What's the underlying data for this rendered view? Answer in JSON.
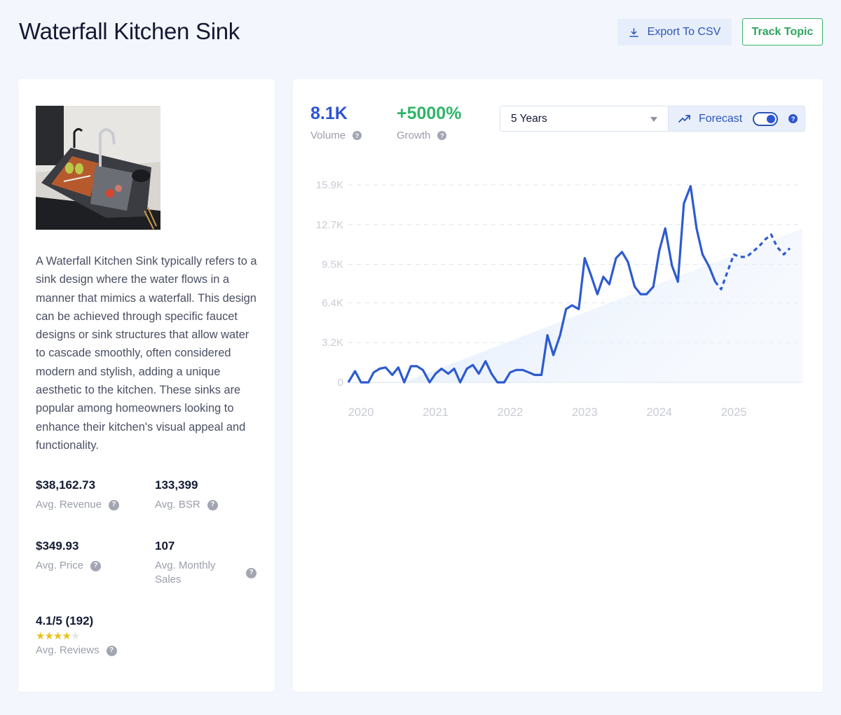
{
  "header": {
    "title": "Waterfall Kitchen Sink",
    "export_label": "Export To CSV",
    "track_label": "Track Topic"
  },
  "product": {
    "image_alt": "Waterfall kitchen sink product photo",
    "description": "A Waterfall Kitchen Sink typically refers to a sink design where the water flows in a manner that mimics a waterfall. This design can be achieved through specific faucet designs or sink structures that allow water to cascade smoothly, often considered modern and stylish, adding a unique aesthetic to the kitchen. These sinks are popular among homeowners looking to enhance their kitchen's visual appeal and functionality.",
    "stats": {
      "revenue": {
        "value": "$38,162.73",
        "label": "Avg. Revenue"
      },
      "bsr": {
        "value": "133,399",
        "label": "Avg. BSR"
      },
      "price": {
        "value": "$349.93",
        "label": "Avg. Price"
      },
      "monthly_sales": {
        "value": "107",
        "label": "Avg. Monthly Sales"
      },
      "reviews": {
        "value": "4.1/5 (192)",
        "label": "Avg. Reviews",
        "rating": 4.1,
        "max": 5,
        "stars_filled": 4
      }
    }
  },
  "metrics": {
    "volume": {
      "value": "8.1K",
      "label": "Volume"
    },
    "growth": {
      "value": "+5000%",
      "label": "Growth"
    }
  },
  "controls": {
    "period_selected": "5 Years",
    "forecast_label": "Forecast",
    "forecast_enabled": true
  },
  "colors": {
    "accent": "#2d55d0",
    "growth": "#2fb56a",
    "line": "#2d5bd0",
    "trend_fill": "#e3eefc",
    "grid": "#dde3ee"
  },
  "chart_data": {
    "type": "line",
    "title": "",
    "xlabel": "",
    "ylabel": "",
    "x_ticks": [
      "2020",
      "2021",
      "2022",
      "2023",
      "2024",
      "2025"
    ],
    "y_ticks": [
      {
        "value": 0,
        "label": "0"
      },
      {
        "value": 3200,
        "label": "3.2K"
      },
      {
        "value": 6400,
        "label": "6.4K"
      },
      {
        "value": 9500,
        "label": "9.5K"
      },
      {
        "value": 12700,
        "label": "12.7K"
      },
      {
        "value": 15900,
        "label": "15.9K"
      }
    ],
    "ylim": [
      0,
      15900
    ],
    "xlim": [
      2019.83,
      2025.92
    ],
    "grid": true,
    "series": [
      {
        "name": "Volume",
        "style": "solid",
        "points": [
          [
            2019.83,
            0
          ],
          [
            2019.92,
            900
          ],
          [
            2020.0,
            0
          ],
          [
            2020.1,
            0
          ],
          [
            2020.17,
            800
          ],
          [
            2020.25,
            1100
          ],
          [
            2020.33,
            1200
          ],
          [
            2020.42,
            600
          ],
          [
            2020.5,
            1200
          ],
          [
            2020.58,
            0
          ],
          [
            2020.67,
            1300
          ],
          [
            2020.75,
            1300
          ],
          [
            2020.83,
            1000
          ],
          [
            2020.92,
            0
          ],
          [
            2021.0,
            700
          ],
          [
            2021.08,
            1100
          ],
          [
            2021.17,
            700
          ],
          [
            2021.25,
            1100
          ],
          [
            2021.33,
            0
          ],
          [
            2021.42,
            1100
          ],
          [
            2021.5,
            1400
          ],
          [
            2021.58,
            700
          ],
          [
            2021.67,
            1700
          ],
          [
            2021.75,
            700
          ],
          [
            2021.83,
            0
          ],
          [
            2021.92,
            0
          ],
          [
            2022.0,
            800
          ],
          [
            2022.08,
            1000
          ],
          [
            2022.17,
            1000
          ],
          [
            2022.25,
            800
          ],
          [
            2022.33,
            600
          ],
          [
            2022.42,
            600
          ],
          [
            2022.5,
            3800
          ],
          [
            2022.58,
            2200
          ],
          [
            2022.67,
            3800
          ],
          [
            2022.75,
            5900
          ],
          [
            2022.83,
            6200
          ],
          [
            2022.92,
            5900
          ],
          [
            2023.0,
            10000
          ],
          [
            2023.08,
            8700
          ],
          [
            2023.17,
            7100
          ],
          [
            2023.25,
            8500
          ],
          [
            2023.33,
            7900
          ],
          [
            2023.42,
            10000
          ],
          [
            2023.5,
            10500
          ],
          [
            2023.58,
            9700
          ],
          [
            2023.67,
            7700
          ],
          [
            2023.75,
            7100
          ],
          [
            2023.83,
            7100
          ],
          [
            2023.92,
            7700
          ],
          [
            2024.0,
            10600
          ],
          [
            2024.08,
            12400
          ],
          [
            2024.17,
            9400
          ],
          [
            2024.25,
            8100
          ],
          [
            2024.33,
            14400
          ],
          [
            2024.42,
            15800
          ],
          [
            2024.5,
            12400
          ],
          [
            2024.58,
            10300
          ],
          [
            2024.67,
            9300
          ],
          [
            2024.75,
            8100
          ]
        ]
      },
      {
        "name": "Forecast",
        "style": "dashed",
        "points": [
          [
            2024.75,
            8100
          ],
          [
            2024.83,
            7500
          ],
          [
            2024.92,
            9000
          ],
          [
            2025.0,
            10300
          ],
          [
            2025.08,
            10100
          ],
          [
            2025.17,
            10100
          ],
          [
            2025.25,
            10500
          ],
          [
            2025.33,
            10900
          ],
          [
            2025.42,
            11500
          ],
          [
            2025.5,
            11900
          ],
          [
            2025.58,
            10900
          ],
          [
            2025.67,
            10300
          ],
          [
            2025.75,
            10800
          ]
        ]
      }
    ],
    "trend": {
      "name": "Trend",
      "start": [
        2020.57,
        0
      ],
      "end": [
        2025.92,
        12400
      ]
    }
  }
}
